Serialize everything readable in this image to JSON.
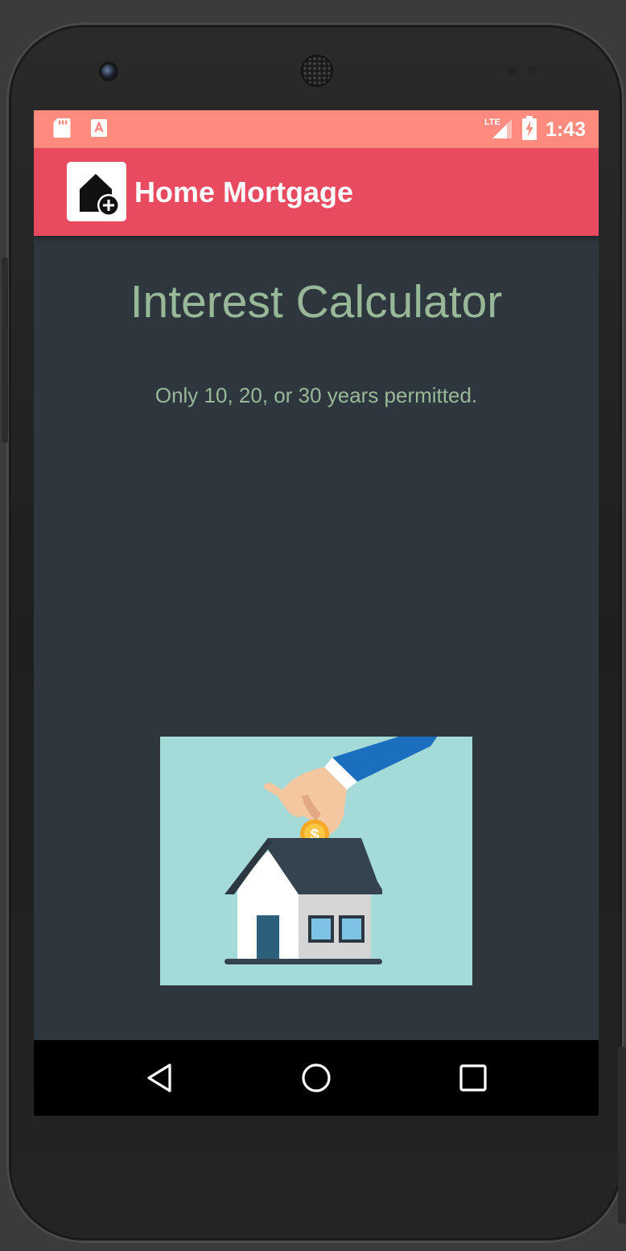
{
  "status_bar": {
    "time": "1:43",
    "network": "LTE",
    "icons": [
      "sd-card-icon",
      "app-notification-icon",
      "lte-signal-icon",
      "battery-charging-icon"
    ]
  },
  "app_bar": {
    "title": "Home Mortgage",
    "icon": "home-plus-icon"
  },
  "main": {
    "heading": "Interest Calculator",
    "subtitle": "Only 10, 20, or 30 years permitted.",
    "illustration": "hand-coin-house-piggy-bank"
  },
  "nav_bar": {
    "buttons": [
      "back-icon",
      "home-icon",
      "recents-icon"
    ]
  },
  "colors": {
    "status_bar": "#ff8a7e",
    "app_bar": "#e84a5f",
    "background": "#2e373e",
    "text_accent": "#99b898",
    "illustration_bg": "#a4dad7"
  }
}
